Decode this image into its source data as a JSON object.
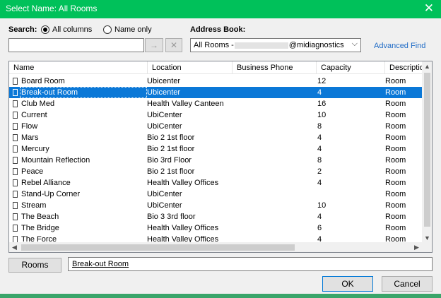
{
  "window": {
    "title": "Select Name: All Rooms",
    "close_label": "✕"
  },
  "search": {
    "label": "Search:",
    "options": [
      {
        "label": "All columns",
        "selected": true
      },
      {
        "label": "Name only",
        "selected": false
      }
    ],
    "value": "",
    "go_label": "→",
    "clear_label": "✕"
  },
  "address_book": {
    "label": "Address Book:",
    "prefix": "All Rooms -",
    "suffix": "@midiagnostics",
    "chevron": "⌵"
  },
  "advanced_find": "Advanced Find",
  "columns": [
    "Name",
    "Location",
    "Business Phone",
    "Capacity",
    "Description"
  ],
  "rooms": [
    {
      "name": "Board Room",
      "location": "Ubicenter",
      "phone": "",
      "capacity": "12",
      "description": "Room",
      "selected": false
    },
    {
      "name": "Break-out Room",
      "location": "Ubicenter",
      "phone": "",
      "capacity": "4",
      "description": "Room",
      "selected": true
    },
    {
      "name": "Club Med",
      "location": "Health Valley Canteen",
      "phone": "",
      "capacity": "16",
      "description": "Room",
      "selected": false
    },
    {
      "name": "Current",
      "location": "UbiCenter",
      "phone": "",
      "capacity": "10",
      "description": "Room",
      "selected": false
    },
    {
      "name": "Flow",
      "location": "UbiCenter",
      "phone": "",
      "capacity": "8",
      "description": "Room",
      "selected": false
    },
    {
      "name": "Mars",
      "location": "Bio 2 1st floor",
      "phone": "",
      "capacity": "4",
      "description": "Room",
      "selected": false
    },
    {
      "name": "Mercury",
      "location": "Bio 2 1st floor",
      "phone": "",
      "capacity": "4",
      "description": "Room",
      "selected": false
    },
    {
      "name": "Mountain Reflection",
      "location": "Bio 3rd Floor",
      "phone": "",
      "capacity": "8",
      "description": "Room",
      "selected": false
    },
    {
      "name": "Peace",
      "location": "Bio 2 1st floor",
      "phone": "",
      "capacity": "2",
      "description": "Room",
      "selected": false
    },
    {
      "name": "Rebel Alliance",
      "location": "Health Valley Offices",
      "phone": "",
      "capacity": "4",
      "description": "Room",
      "selected": false
    },
    {
      "name": "Stand-Up Corner",
      "location": "UbiCenter",
      "phone": "",
      "capacity": "",
      "description": "Room",
      "selected": false
    },
    {
      "name": "Stream",
      "location": "UbiCenter",
      "phone": "",
      "capacity": "10",
      "description": "Room",
      "selected": false
    },
    {
      "name": "The Beach",
      "location": "Bio 3 3rd floor",
      "phone": "",
      "capacity": "4",
      "description": "Room",
      "selected": false
    },
    {
      "name": "The Bridge",
      "location": "Health Valley Offices",
      "phone": "",
      "capacity": "6",
      "description": "Room",
      "selected": false
    },
    {
      "name": "The Force",
      "location": "Health Valley Offices",
      "phone": "",
      "capacity": "4",
      "description": "Room",
      "selected": false
    }
  ],
  "rooms_button": "Rooms",
  "selected_value": "Break-out Room",
  "ok_label": "OK",
  "cancel_label": "Cancel",
  "colors": {
    "titlebar": "#00c15a",
    "selection": "#0b78d7",
    "link": "#1f6bc6"
  }
}
